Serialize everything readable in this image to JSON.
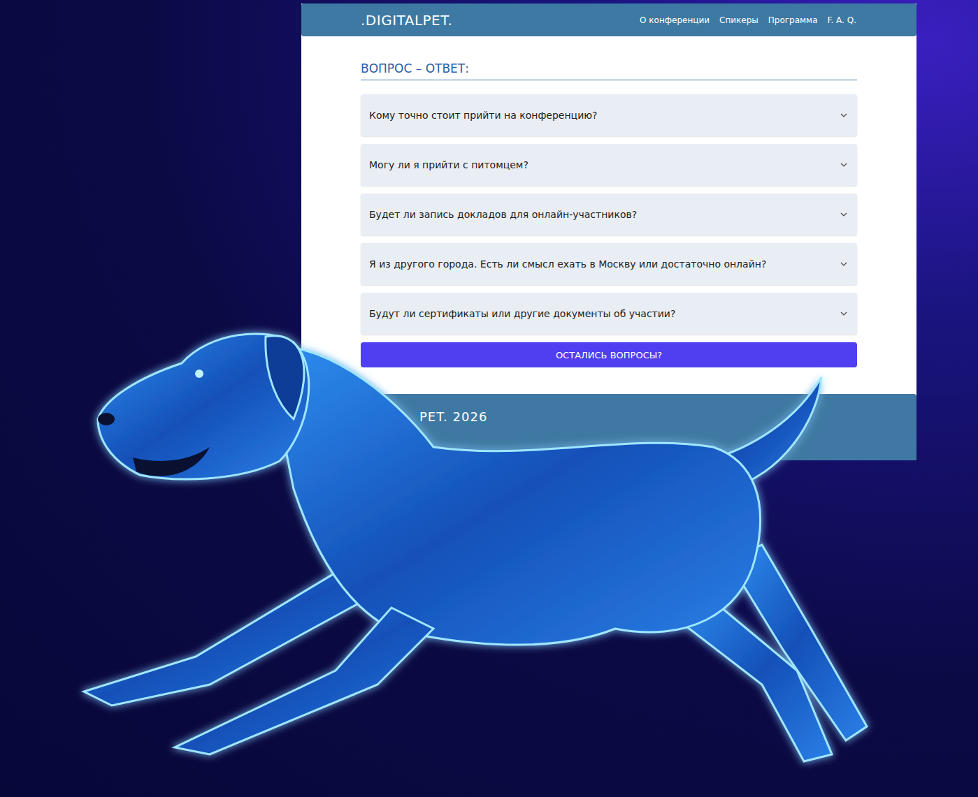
{
  "site": {
    "logo": ".DIGITALPET.",
    "nav": [
      {
        "label": "О конференции",
        "selected": false
      },
      {
        "label": "Спикеры",
        "selected": false
      },
      {
        "label": "Программа",
        "selected": false
      },
      {
        "label": "F. A. Q.",
        "selected": false
      }
    ]
  },
  "faq": {
    "title": "ВОПРОС – ОТВЕТ:",
    "items": [
      {
        "question": "Кому точно стоит прийти на конференцию?",
        "expanded": false
      },
      {
        "question": "Могу ли я прийти с питомцем?",
        "expanded": false
      },
      {
        "question": "Будет ли запись докладов для онлайн-участников?",
        "expanded": false
      },
      {
        "question": "Я из другого города. Есть ли смысл ехать в Москву или достаточно онлайн?",
        "expanded": false
      },
      {
        "question": "Будут ли сертификаты или другие документы об участии?",
        "expanded": false
      }
    ]
  },
  "button": "ОСТАЛИСЬ ВОПРОСЫ?",
  "footer": {
    "title": "PET. 2026"
  }
}
